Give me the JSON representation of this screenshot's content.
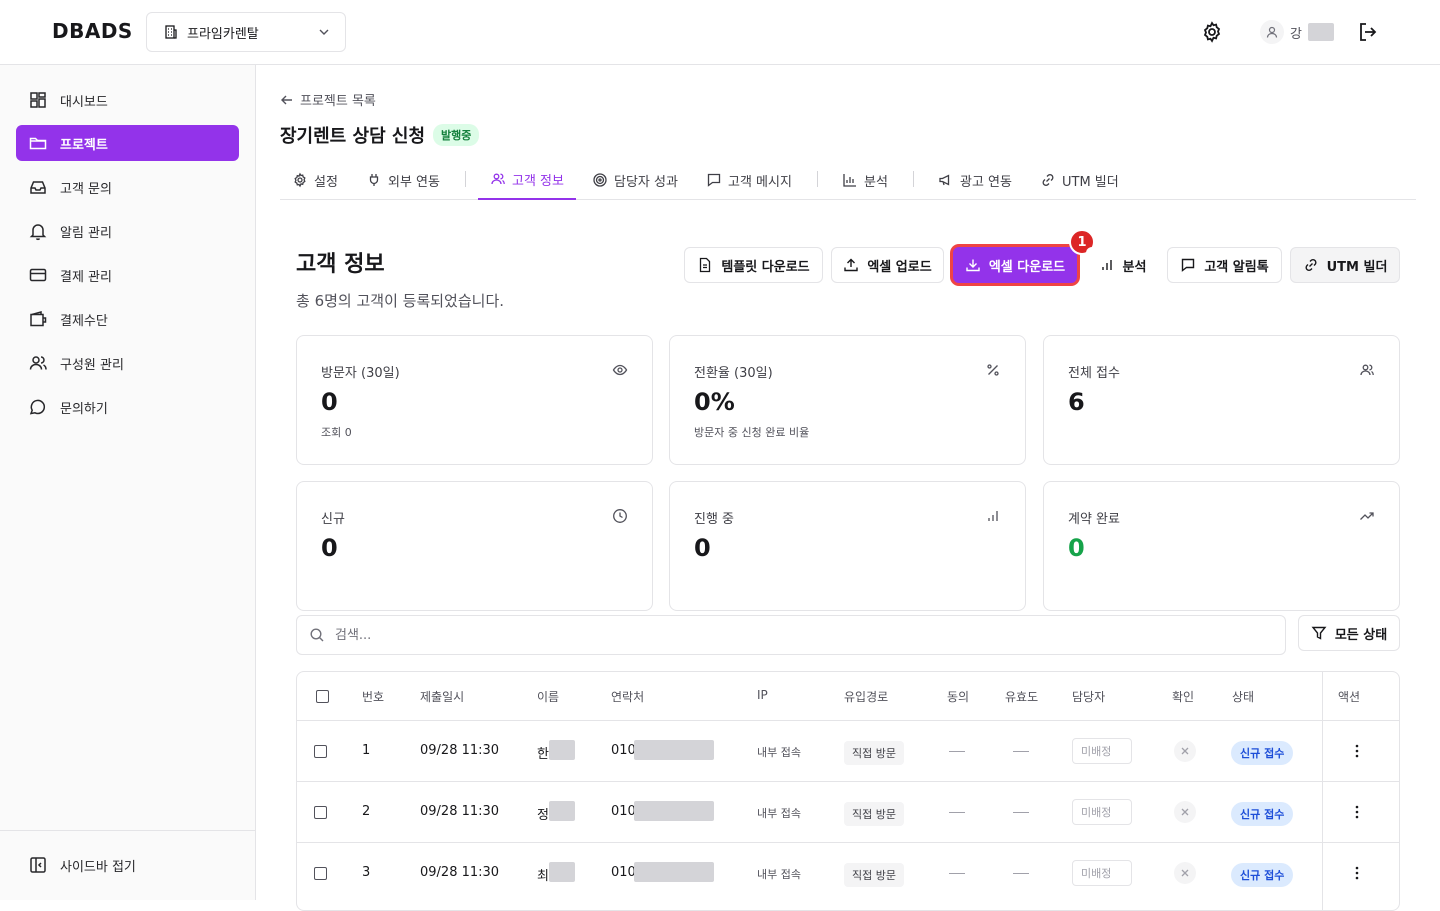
{
  "header": {
    "logo": "DBADS",
    "org_name": "프라임카렌탈",
    "user_initial": "강"
  },
  "sidebar": {
    "items": [
      {
        "label": "대시보드",
        "icon": "dashboard-icon"
      },
      {
        "label": "프로젝트",
        "icon": "folder-icon",
        "active": true
      },
      {
        "label": "고객 문의",
        "icon": "inbox-icon"
      },
      {
        "label": "알림 관리",
        "icon": "bell-icon"
      },
      {
        "label": "결제 관리",
        "icon": "card-icon"
      },
      {
        "label": "결제수단",
        "icon": "wallet-icon"
      },
      {
        "label": "구성원 관리",
        "icon": "users-icon"
      },
      {
        "label": "문의하기",
        "icon": "chat-icon"
      }
    ],
    "collapse_label": "사이드바 접기"
  },
  "breadcrumb": "프로젝트 목록",
  "project": {
    "title": "장기렌트 상담 신청",
    "status": "발행중"
  },
  "tabs": [
    {
      "label": "설정"
    },
    {
      "label": "외부 연동"
    },
    {
      "label": "고객 정보",
      "active": true
    },
    {
      "label": "담당자 성과"
    },
    {
      "label": "고객 메시지"
    },
    {
      "label": "분석"
    },
    {
      "label": "광고 연동"
    },
    {
      "label": "UTM 빌더"
    }
  ],
  "section": {
    "title": "고객 정보",
    "subtitle": "총 6명의 고객이 등록되었습니다."
  },
  "actions": {
    "template_download": "템플릿 다운로드",
    "excel_upload": "엑셀 업로드",
    "excel_download": "엑셀 다운로드",
    "analysis": "분석",
    "alimtalk": "고객 알림톡",
    "utm_builder": "UTM 빌더",
    "step_badge": "1"
  },
  "stats": [
    {
      "label": "방문자 (30일)",
      "value": "0",
      "sub": "조회 0",
      "icon": "eye-icon"
    },
    {
      "label": "전환율 (30일)",
      "value": "0%",
      "sub": "방문자 중 신청 완료 비율",
      "icon": "percent-icon"
    },
    {
      "label": "전체 접수",
      "value": "6",
      "sub": "",
      "icon": "users-icon"
    },
    {
      "label": "신규",
      "value": "0",
      "sub": "",
      "icon": "clock-icon"
    },
    {
      "label": "진행 중",
      "value": "0",
      "sub": "",
      "icon": "bar-chart-icon"
    },
    {
      "label": "계약 완료",
      "value": "0",
      "sub": "",
      "icon": "trending-up-icon",
      "color": "#16a34a"
    }
  ],
  "search": {
    "placeholder": "검색..."
  },
  "filter_label": "모든 상태",
  "table": {
    "headers": [
      "번호",
      "제출일시",
      "이름",
      "연락처",
      "IP",
      "유입경로",
      "동의",
      "유효도",
      "담당자",
      "확인",
      "상태",
      "액션"
    ],
    "rows": [
      {
        "no": "1",
        "date": "09/28 11:30",
        "name": "한",
        "phone": "010",
        "ip": "내부 접속",
        "source": "직접 방문",
        "assignee": "미배정",
        "status": "신규 접수"
      },
      {
        "no": "2",
        "date": "09/28 11:30",
        "name": "정",
        "phone": "010",
        "ip": "내부 접속",
        "source": "직접 방문",
        "assignee": "미배정",
        "status": "신규 접수"
      },
      {
        "no": "3",
        "date": "09/28 11:30",
        "name": "최",
        "phone": "010",
        "ip": "내부 접속",
        "source": "직접 방문",
        "assignee": "미배정",
        "status": "신규 접수"
      }
    ]
  },
  "colors": {
    "accent": "#9333ea",
    "highlight": "#ef4444",
    "success": "#16a34a",
    "status_blue": "#1d4ed8"
  }
}
